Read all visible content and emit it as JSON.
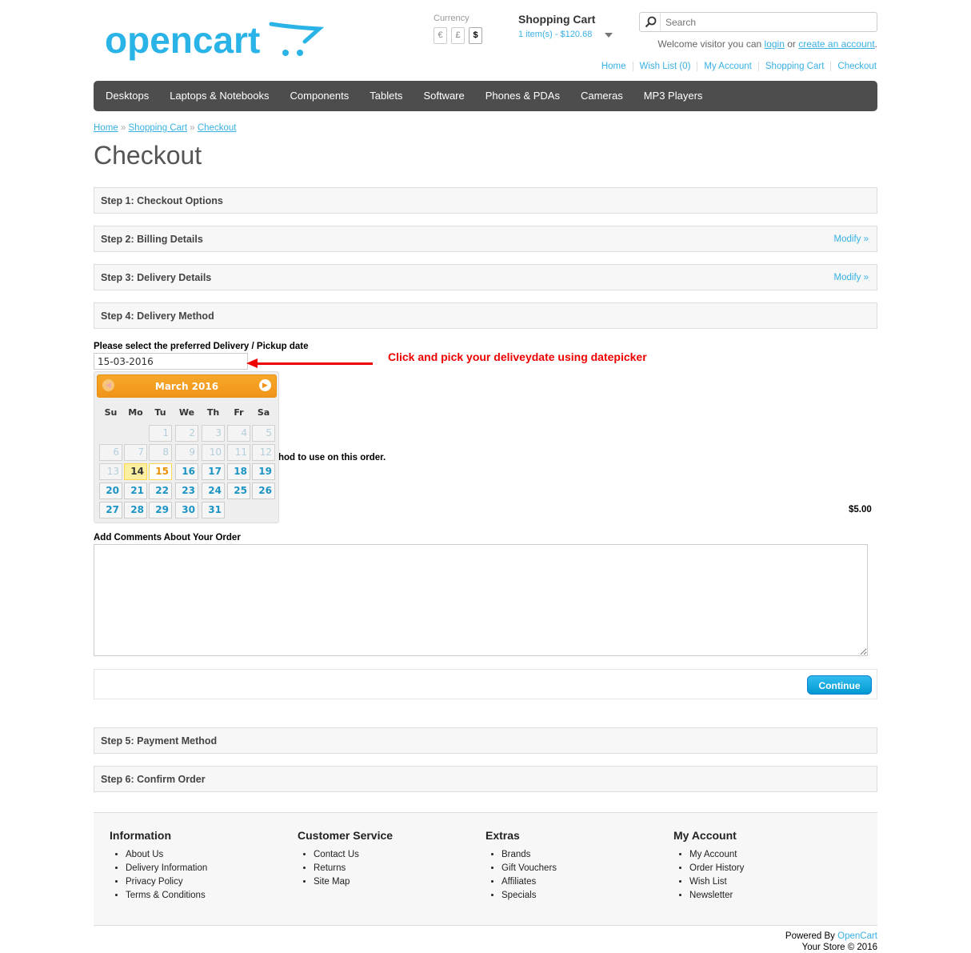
{
  "header": {
    "logo_text": "opencart",
    "currency_label": "Currency",
    "currencies": [
      "€",
      "£",
      "$"
    ],
    "cart_title": "Shopping Cart",
    "cart_summary": "1 item(s) - $120.68",
    "search_placeholder": "Search",
    "welcome_prefix": "Welcome visitor you can",
    "login": "login",
    "or": "or",
    "create_account": "create an account",
    "welcome_suffix": ".",
    "links": [
      "Home",
      "Wish List (0)",
      "My Account",
      "Shopping Cart",
      "Checkout"
    ]
  },
  "menu": [
    "Desktops",
    "Laptops & Notebooks",
    "Components",
    "Tablets",
    "Software",
    "Phones & PDAs",
    "Cameras",
    "MP3 Players"
  ],
  "breadcrumb": {
    "items": [
      "Home",
      "Shopping Cart",
      "Checkout"
    ],
    "sep": "»"
  },
  "page_title": "Checkout",
  "steps": [
    {
      "title": "Step 1: Checkout Options",
      "modify": ""
    },
    {
      "title": "Step 2: Billing Details",
      "modify": "Modify »"
    },
    {
      "title": "Step 3: Delivery Details",
      "modify": "Modify »"
    },
    {
      "title": "Step 4: Delivery Method",
      "modify": ""
    },
    {
      "title": "Step 5: Payment Method",
      "modify": ""
    },
    {
      "title": "Step 6: Confirm Order",
      "modify": ""
    }
  ],
  "delivery": {
    "date_label": "Please select the preferred Delivery / Pickup date",
    "date_value": "15-03-2016",
    "annotation": "Click and pick your deliveydate using datepicker",
    "method_text_partial": "hod to use on this order.",
    "price": "$5.00",
    "comments_label": "Add Comments About Your Order",
    "continue": "Continue"
  },
  "datepicker": {
    "month_title": "March 2016",
    "prev": "◀",
    "next": "▶",
    "days_of_week": [
      "Su",
      "Mo",
      "Tu",
      "We",
      "Th",
      "Fr",
      "Sa"
    ],
    "weeks": [
      [
        "",
        "",
        "1",
        "2",
        "3",
        "4",
        "5"
      ],
      [
        "6",
        "7",
        "8",
        "9",
        "10",
        "11",
        "12"
      ],
      [
        "13",
        "14",
        "15",
        "16",
        "17",
        "18",
        "19"
      ],
      [
        "20",
        "21",
        "22",
        "23",
        "24",
        "25",
        "26"
      ],
      [
        "27",
        "28",
        "29",
        "30",
        "31",
        "",
        ""
      ]
    ],
    "disabled_through": 13,
    "today": "14",
    "selected": "15"
  },
  "footer": {
    "columns": [
      {
        "title": "Information",
        "items": [
          "About Us",
          "Delivery Information",
          "Privacy Policy",
          "Terms & Conditions"
        ]
      },
      {
        "title": "Customer Service",
        "items": [
          "Contact Us",
          "Returns",
          "Site Map"
        ]
      },
      {
        "title": "Extras",
        "items": [
          "Brands",
          "Gift Vouchers",
          "Affiliates",
          "Specials"
        ]
      },
      {
        "title": "My Account",
        "items": [
          "My Account",
          "Order History",
          "Wish List",
          "Newsletter"
        ]
      }
    ],
    "powered_by": "Powered By",
    "powered_link": "OpenCart",
    "copyright": "Your Store © 2016"
  },
  "colors": {
    "accent": "#38b0e3",
    "menu_bg": "#4d4d4d",
    "datepicker_header": "#f6a828",
    "annotation": "#ee0000",
    "button": "#019ad2"
  }
}
